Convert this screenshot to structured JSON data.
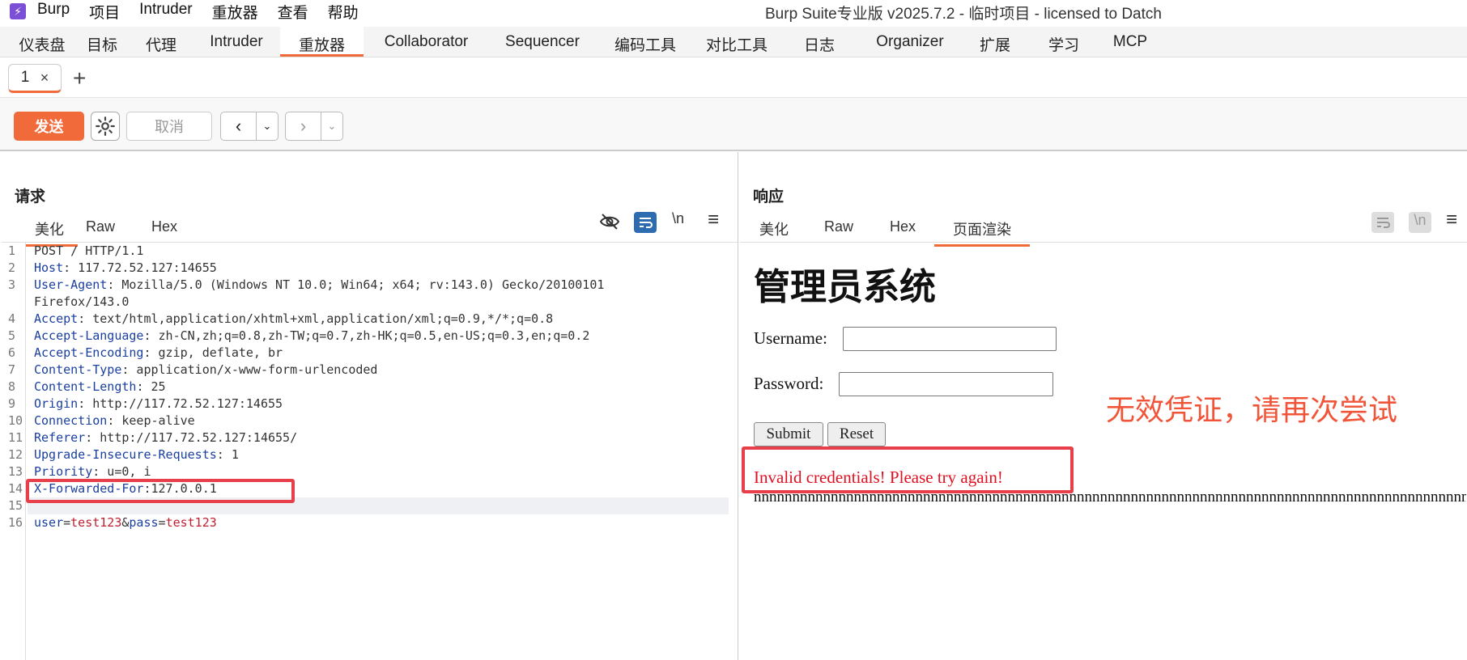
{
  "app": {
    "logo": "⚡",
    "window_title": "Burp Suite专业版  v2025.7.2 - 临时项目 - licensed to Datch"
  },
  "menu": [
    "Burp",
    "项目",
    "Intruder",
    "重放器",
    "查看",
    "帮助"
  ],
  "main_tabs": [
    "仪表盘",
    "目标",
    "代理",
    "Intruder",
    "重放器",
    "Collaborator",
    "Sequencer",
    "编码工具",
    "对比工具",
    "日志",
    "Organizer",
    "扩展",
    "学习",
    "MCP"
  ],
  "active_main_tab": "重放器",
  "repeater_tab": {
    "label": "1",
    "close": "×",
    "add": "+"
  },
  "toolbar": {
    "send": "发送",
    "cancel": "取消",
    "prev": "‹",
    "next": "›",
    "dropdown": "⌄"
  },
  "request": {
    "title": "请求",
    "tabs": [
      "美化",
      "Raw",
      "Hex"
    ],
    "active_tab": "美化",
    "icons": {
      "wrap": "\\n",
      "menu": "≡"
    },
    "lines": [
      {
        "n": "1",
        "k": "POST / HTTP/1.1",
        "v": ""
      },
      {
        "n": "2",
        "k": "Host",
        "v": ": 117.72.52.127:14655"
      },
      {
        "n": "3",
        "k": "User-Agent",
        "v": ": Mozilla/5.0 (Windows NT 10.0; Win64; x64; rv:143.0) Gecko/20100101"
      },
      {
        "n": "",
        "k": "",
        "v": "Firefox/143.0"
      },
      {
        "n": "4",
        "k": "Accept",
        "v": ": text/html,application/xhtml+xml,application/xml;q=0.9,*/*;q=0.8"
      },
      {
        "n": "5",
        "k": "Accept-Language",
        "v": ": zh-CN,zh;q=0.8,zh-TW;q=0.7,zh-HK;q=0.5,en-US;q=0.3,en;q=0.2"
      },
      {
        "n": "6",
        "k": "Accept-Encoding",
        "v": ": gzip, deflate, br"
      },
      {
        "n": "7",
        "k": "Content-Type",
        "v": ": application/x-www-form-urlencoded"
      },
      {
        "n": "8",
        "k": "Content-Length",
        "v": ": 25"
      },
      {
        "n": "9",
        "k": "Origin",
        "v": ": http://117.72.52.127:14655"
      },
      {
        "n": "10",
        "k": "Connection",
        "v": ": keep-alive"
      },
      {
        "n": "11",
        "k": "Referer",
        "v": ": http://117.72.52.127:14655/"
      },
      {
        "n": "12",
        "k": "Upgrade-Insecure-Requests",
        "v": ": 1"
      },
      {
        "n": "13",
        "k": "Priority",
        "v": ": u=0, i"
      },
      {
        "n": "14",
        "k": "X-Forwarded-For",
        "v": ":127.0.0.1"
      },
      {
        "n": "15",
        "k": "",
        "v": ""
      }
    ],
    "body": {
      "n": "16",
      "k1": "user",
      "eq1": "=",
      "v1": "test123",
      "amp": "&",
      "k2": "pass",
      "eq2": "=",
      "v2": "test123"
    }
  },
  "response": {
    "title": "响应",
    "tabs": [
      "美化",
      "Raw",
      "Hex",
      "页面渲染"
    ],
    "active_tab": "页面渲染",
    "icons": {
      "wrap": "\\n",
      "menu": "≡"
    },
    "page": {
      "heading": "管理员系统",
      "username_label": "Username:",
      "password_label": "Password:",
      "submit": "Submit",
      "reset": "Reset",
      "error": "Invalid credentials! Please try again!",
      "trailing": "nnnnnnnnnnnnnnnnnnnnnnnnnnnnnnnnnnnnnnnnnnnnnnnnnnnnnnnnnnnnnnnnnnnnnnnnnnnnnnnnnnnnnnnnnnnnnnnnnnnnnnnnnnnnnnn"
    }
  },
  "annotation": "无效凭证，请再次尝试",
  "colors": {
    "accent": "#f06a3a",
    "highlight": "#e8404a",
    "error": "#e01020",
    "note": "#f0553a"
  }
}
